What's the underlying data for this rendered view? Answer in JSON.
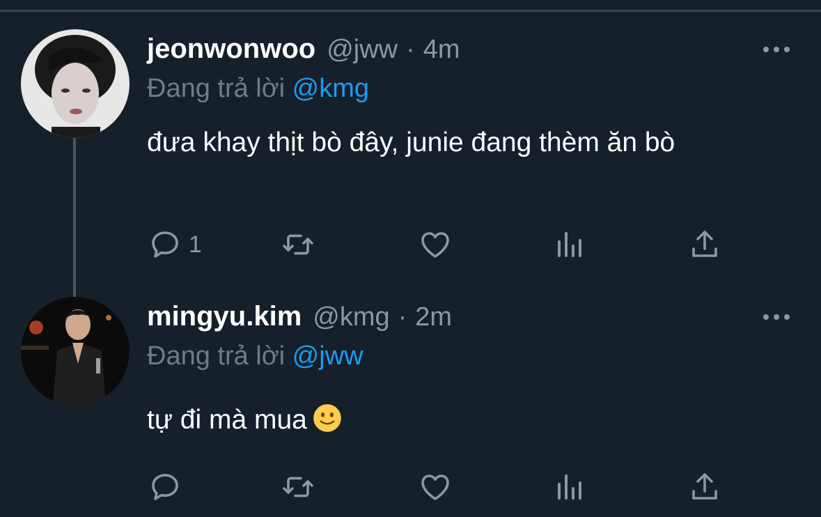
{
  "tweets": [
    {
      "name": "jeonwonwoo",
      "handle": "@jww",
      "separator": "·",
      "time": "4m",
      "reply_prefix": "Đang trả lời",
      "reply_to": "@kmg",
      "text": "đưa khay thịt bò đây, junie đang thèm ăn bò",
      "reply_count": "1"
    },
    {
      "name": "mingyu.kim",
      "handle": "@kmg",
      "separator": "·",
      "time": "2m",
      "reply_prefix": "Đang trả lời",
      "reply_to": "@jww",
      "text": "tự đi mà mua",
      "emoji": "slightly-smiling-face",
      "reply_count": ""
    }
  ],
  "colors": {
    "background": "#15202b",
    "primary_text": "#ffffff",
    "secondary_text": "#8b98a5",
    "mention": "#1d9bf0",
    "thread_line": "#4a5561"
  }
}
